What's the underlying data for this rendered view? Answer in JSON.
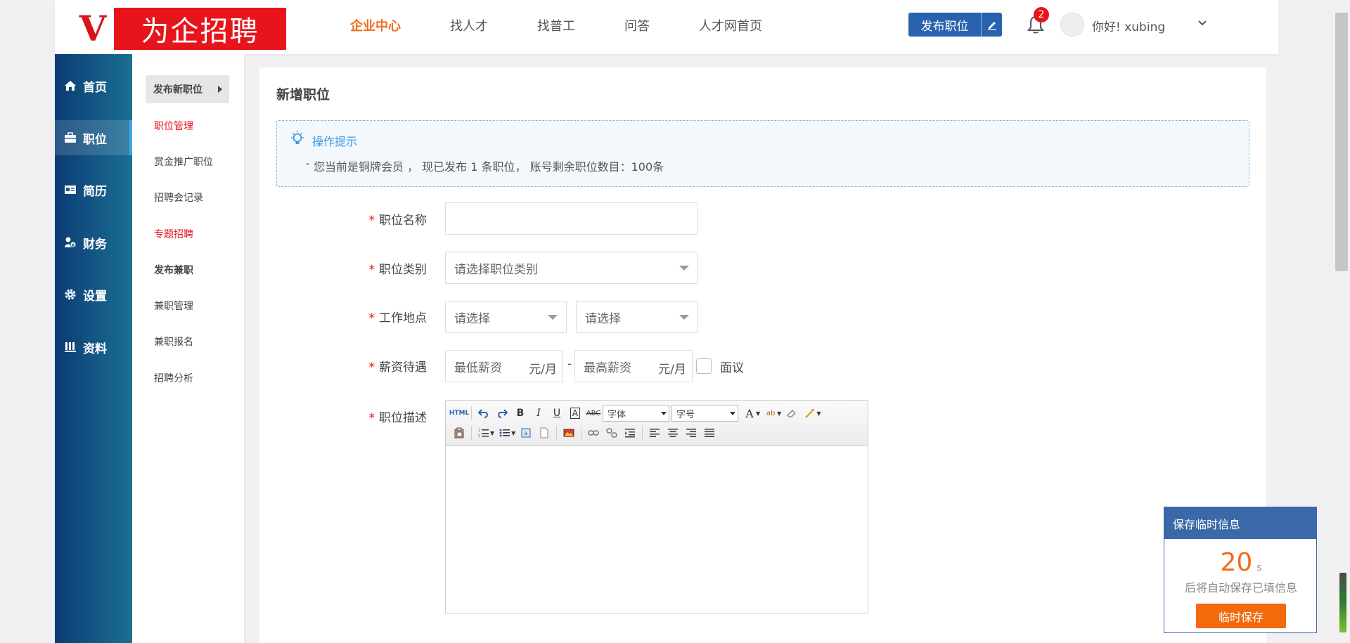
{
  "header": {
    "logo_letter": "V",
    "logo_text": "为企招聘",
    "nav": [
      {
        "label": "企业中心",
        "active": true
      },
      {
        "label": "找人才",
        "active": false
      },
      {
        "label": "找普工",
        "active": false
      },
      {
        "label": "问答",
        "active": false
      },
      {
        "label": "人才网首页",
        "active": false
      }
    ],
    "publish_label": "发布职位",
    "notification_count": "2",
    "greeting": "你好!  xubing",
    "accent_color": "#f26a1b",
    "brand_color": "#2a63ad"
  },
  "sidebar": {
    "items": [
      {
        "label": "首页",
        "icon": "home-icon",
        "active": false
      },
      {
        "label": "职位",
        "icon": "briefcase-icon",
        "active": true
      },
      {
        "label": "简历",
        "icon": "id-card-icon",
        "active": false
      },
      {
        "label": "财务",
        "icon": "finance-icon",
        "active": false
      },
      {
        "label": "设置",
        "icon": "gear-icon",
        "active": false
      },
      {
        "label": "资料",
        "icon": "profile-icon",
        "active": false
      }
    ]
  },
  "subnav": {
    "button_label": "发布新职位",
    "items": [
      {
        "label": "职位管理",
        "style": "red"
      },
      {
        "label": "赏金推广职位",
        "style": "normal"
      },
      {
        "label": "招聘会记录",
        "style": "normal"
      },
      {
        "label": "专题招聘",
        "style": "red"
      },
      {
        "label": "发布兼职",
        "style": "bold"
      },
      {
        "label": "兼职管理",
        "style": "normal"
      },
      {
        "label": "兼职报名",
        "style": "normal"
      },
      {
        "label": "招聘分析",
        "style": "normal"
      }
    ]
  },
  "main": {
    "title": "新增职位",
    "tip": {
      "title": "操作提示",
      "text": "您当前是铜牌会员 ， 现已发布 1 条职位， 账号剩余职位数目：100条"
    },
    "form": {
      "required_mark": "*",
      "job_name_label": "职位名称",
      "job_name_value": "",
      "job_category_label": "职位类别",
      "job_category_placeholder": "请选择职位类别",
      "location_label": "工作地点",
      "location_province_placeholder": "请选择",
      "location_city_placeholder": "请选择",
      "salary_label": "薪资待遇",
      "salary_min_placeholder": "最低薪资",
      "salary_max_placeholder": "最高薪资",
      "salary_unit": "元/月",
      "salary_separator": "-",
      "negotiable_label": "面议",
      "description_label": "职位描述",
      "font_select": "字体",
      "size_select": "字号",
      "html_button": "HTML"
    }
  },
  "save_panel": {
    "title": "保存临时信息",
    "countdown": "20",
    "unit": "s",
    "text": "后将自动保存已填信息",
    "button": "临时保存"
  }
}
